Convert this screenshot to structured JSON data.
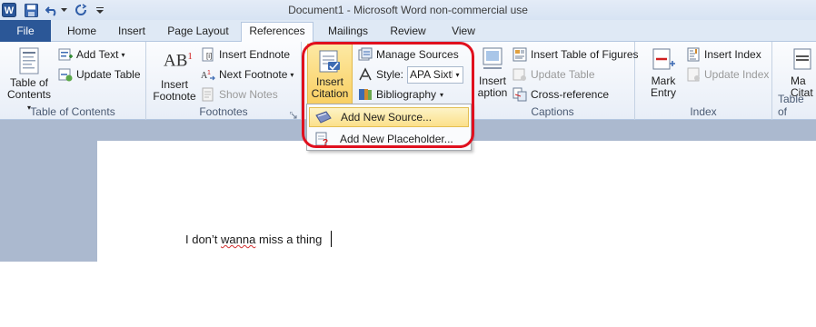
{
  "window": {
    "title": "Document1  -  Microsoft Word non-commercial use"
  },
  "qat": {
    "word_icon_letter": "W",
    "icons": [
      "word-app-icon",
      "save-icon",
      "undo-icon",
      "undo-dropdown-icon",
      "redo-icon",
      "customize-qat-icon"
    ]
  },
  "tabs": {
    "file": "File",
    "home": "Home",
    "insert": "Insert",
    "page_layout": "Page Layout",
    "references": "References",
    "mailings": "Mailings",
    "review": "Review",
    "view": "View",
    "active": "References"
  },
  "ribbon": {
    "toc": {
      "button_line1": "Table of",
      "button_line2": "Contents",
      "add_text": "Add Text",
      "update_table": "Update Table",
      "group_label": "Table of Contents"
    },
    "footnotes": {
      "insert_footnote_line1": "Insert",
      "insert_footnote_line2": "Footnote",
      "insert_endnote": "Insert Endnote",
      "next_footnote": "Next Footnote",
      "show_notes": "Show Notes",
      "group_label": "Footnotes",
      "ab_glyph": "AB",
      "ab_super": "1"
    },
    "citations": {
      "insert_citation_line1": "Insert",
      "insert_citation_line2": "Citation",
      "manage_sources": "Manage Sources",
      "style_label": "Style:",
      "style_value": "APA Sixtl",
      "bibliography": "Bibliography"
    },
    "captions": {
      "insert_caption_line1": "Insert",
      "insert_caption_line2": "aption",
      "insert_table_of_figures": "Insert Table of Figures",
      "update_table": "Update Table",
      "cross_reference": "Cross-reference",
      "group_label": "Captions"
    },
    "index": {
      "mark_entry_line1": "Mark",
      "mark_entry_line2": "Entry",
      "insert_index": "Insert Index",
      "update_index": "Update Index",
      "group_label": "Index"
    },
    "toa": {
      "mark_citation_line1": "Ma",
      "mark_citation_line2": "Citat",
      "group_label": "Table of"
    }
  },
  "dropdown_menu": {
    "add_new_source": "Add New Source...",
    "add_new_placeholder": "Add New Placeholder..."
  },
  "document": {
    "word1": "I don’t ",
    "word2": "wanna",
    "word3": " miss a thing"
  },
  "colors": {
    "file_tab": "#2b5797",
    "highlight_ring": "#e0101e",
    "menu_hover": "#fbe08a",
    "doc_background": "#abb9cf"
  }
}
